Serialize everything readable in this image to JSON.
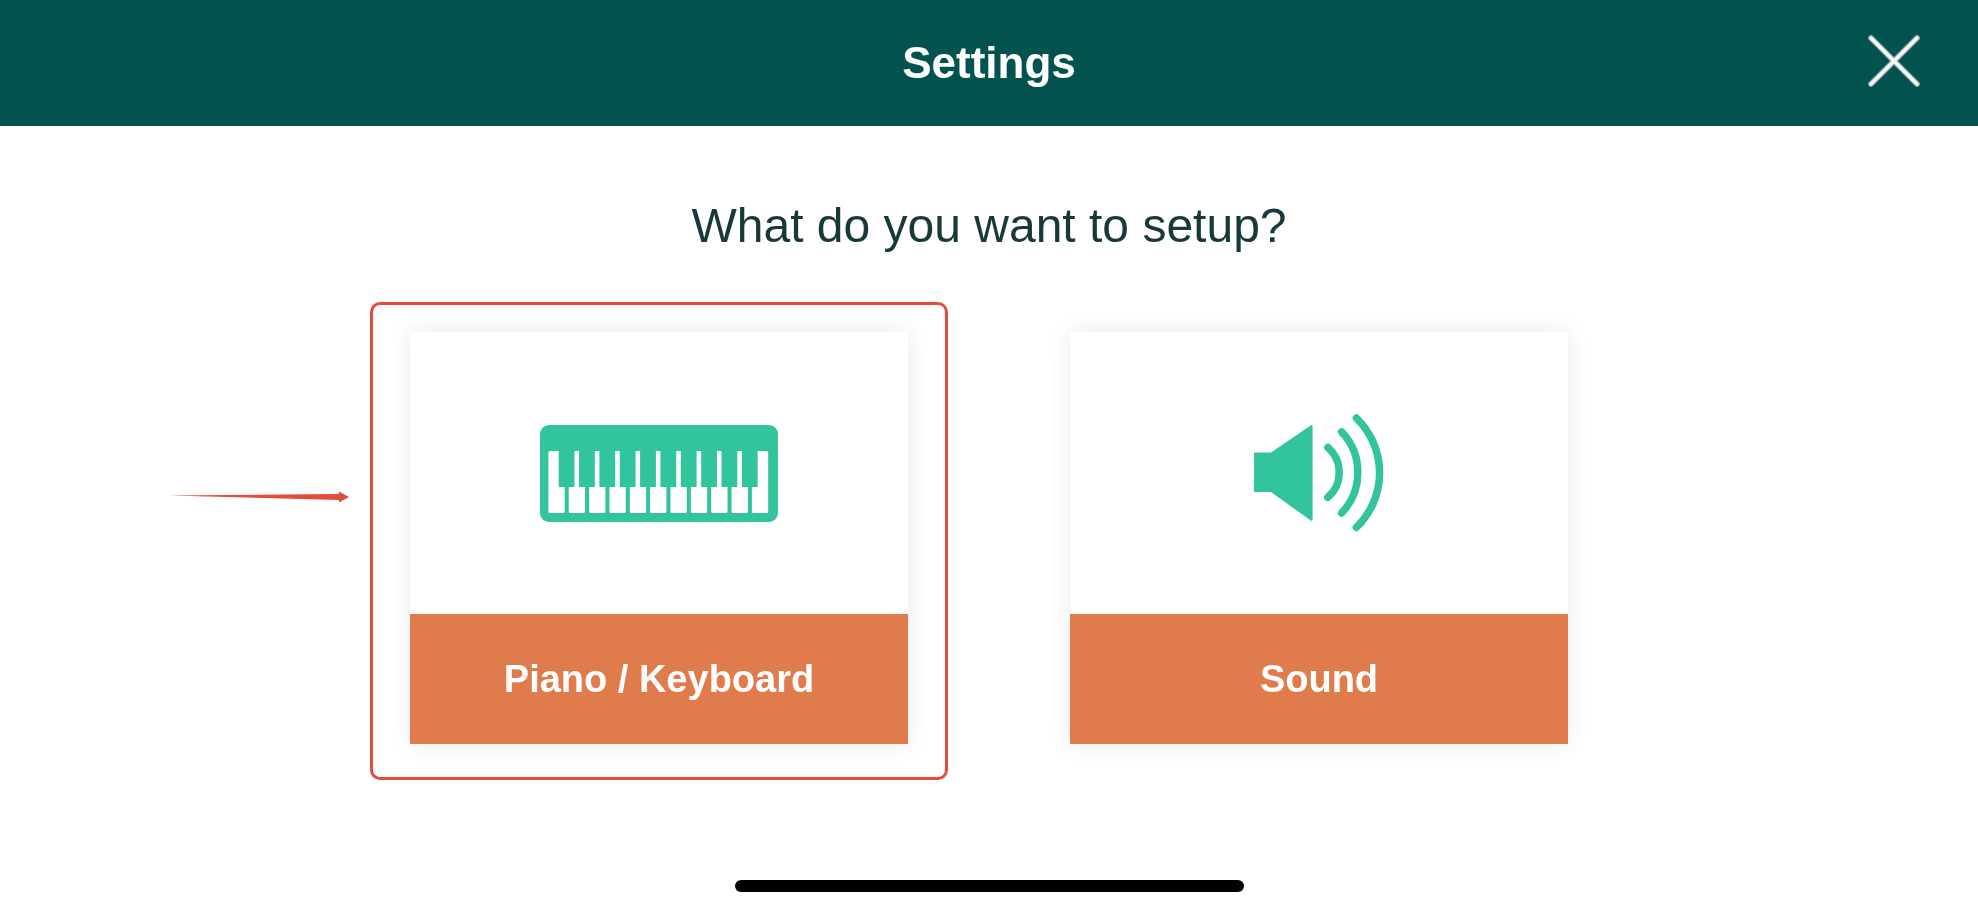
{
  "header": {
    "title": "Settings"
  },
  "prompt": "What do you want to setup?",
  "options": [
    {
      "kind": "piano",
      "label": "Piano / Keyboard",
      "highlighted": true
    },
    {
      "kind": "sound",
      "label": "Sound",
      "highlighted": false
    }
  ]
}
